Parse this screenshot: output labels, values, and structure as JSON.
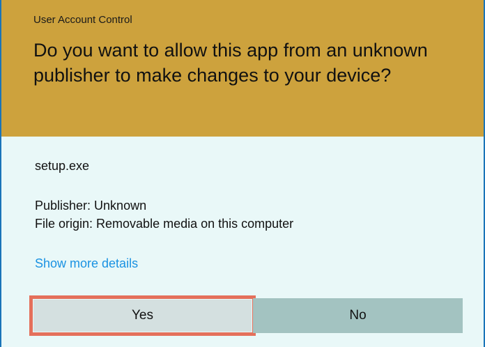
{
  "dialog": {
    "caption": "User Account Control",
    "question": "Do you want to allow this app from an unknown publisher to make changes to your device?",
    "app_name": "setup.exe",
    "publisher": "Publisher: Unknown",
    "file_origin": "File origin: Removable media on this computer",
    "details_link": "Show more details",
    "yes_label": "Yes",
    "no_label": "No"
  },
  "colors": {
    "header": "#cda23d",
    "body": "#e9f8f8",
    "border": "#1a74b8",
    "link": "#1a92e2",
    "yes_button": "#d4e0e0",
    "no_button": "#a3c3c1",
    "highlight": "#e4705b"
  }
}
